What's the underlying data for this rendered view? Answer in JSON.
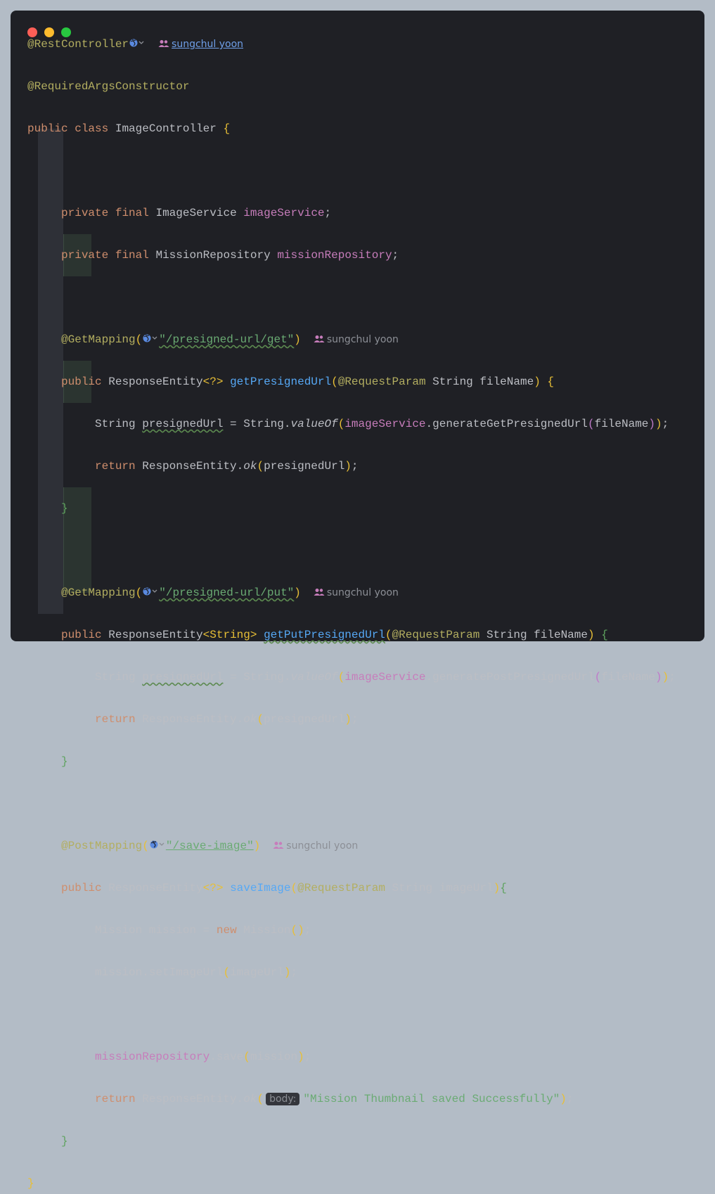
{
  "window": {
    "controls": [
      "close",
      "minimize",
      "zoom"
    ]
  },
  "author": "sungchul yoon",
  "hint_label": "body:",
  "colors": {
    "background": "#1f2025",
    "annotation": "#b3ae60",
    "keyword": "#cf8e6d",
    "field": "#c77dbb",
    "method": "#56a8f5",
    "string": "#6aab73"
  },
  "code": {
    "ann_rest": "@RestController",
    "ann_required": "@RequiredArgsConstructor",
    "kw_public": "public",
    "kw_class": "class",
    "class_name": "ImageController",
    "brace_open": "{",
    "brace_close": "}",
    "kw_private": "private",
    "kw_final": "final",
    "type_image_service": "ImageService",
    "field_image_service": "imageService",
    "type_mission_repo": "MissionRepository",
    "field_mission_repo": "missionRepository",
    "ann_get": "@GetMapping",
    "ann_post": "@PostMapping",
    "path_get": "\"/presigned-url/get\"",
    "path_put": "\"/presigned-url/put\"",
    "path_save": "\"/save-image\"",
    "type_response_entity": "ResponseEntity",
    "generic_wild": "<?>",
    "generic_string": "<String>",
    "fn_get": "getPresignedUrl",
    "fn_put": "getPutPresignedUrl",
    "fn_save": "saveImage",
    "ann_request_param": "@RequestParam",
    "type_string": "String",
    "param_file_name": "fileName",
    "param_image_url": "imageUrl",
    "var_presigned": "presignedUrl",
    "method_value_of": "valueOf",
    "method_gen_get": "generateGetPresignedUrl",
    "method_gen_post": "generatePostPresignedUrl",
    "kw_return": "return",
    "method_ok": "ok",
    "type_mission": "Mission",
    "var_mission": "mission",
    "kw_new": "new",
    "method_set_image_url": "setImageUrl",
    "method_save": "save",
    "str_saved": "\"Mission Thumbnail saved Successfully\""
  }
}
